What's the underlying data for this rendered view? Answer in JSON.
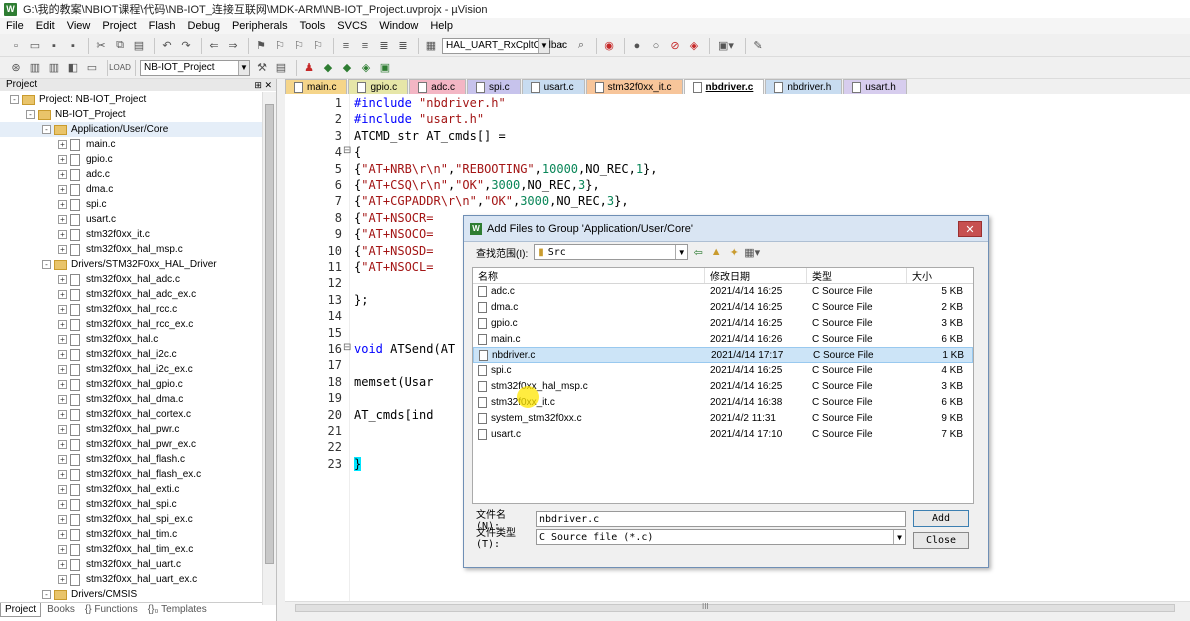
{
  "window": {
    "title": "G:\\我的教案\\NBIOT课程\\代码\\NB-IOT_连接互联网\\MDK-ARM\\NB-IOT_Project.uvprojx - µVision"
  },
  "menu": [
    "File",
    "Edit",
    "View",
    "Project",
    "Flash",
    "Debug",
    "Peripherals",
    "Tools",
    "SVCS",
    "Window",
    "Help"
  ],
  "toolbar": {
    "function_combo": "HAL_UART_RxCpltCallbac",
    "target_combo": "NB-IOT_Project"
  },
  "project_panel": {
    "title": "Project",
    "tree": [
      {
        "level": 0,
        "kind": "root",
        "label": "Project: NB-IOT_Project",
        "exp": "-"
      },
      {
        "level": 1,
        "kind": "target",
        "label": "NB-IOT_Project",
        "exp": "-"
      },
      {
        "level": 2,
        "kind": "folder",
        "label": "Application/User/Core",
        "exp": "-"
      },
      {
        "level": 3,
        "kind": "file",
        "label": "main.c",
        "exp": "+"
      },
      {
        "level": 3,
        "kind": "file",
        "label": "gpio.c",
        "exp": "+"
      },
      {
        "level": 3,
        "kind": "file",
        "label": "adc.c",
        "exp": "+"
      },
      {
        "level": 3,
        "kind": "file",
        "label": "dma.c",
        "exp": "+"
      },
      {
        "level": 3,
        "kind": "file",
        "label": "spi.c",
        "exp": "+"
      },
      {
        "level": 3,
        "kind": "file",
        "label": "usart.c",
        "exp": "+"
      },
      {
        "level": 3,
        "kind": "file",
        "label": "stm32f0xx_it.c",
        "exp": "+"
      },
      {
        "level": 3,
        "kind": "file",
        "label": "stm32f0xx_hal_msp.c",
        "exp": "+"
      },
      {
        "level": 2,
        "kind": "folder",
        "label": "Drivers/STM32F0xx_HAL_Driver",
        "exp": "-"
      },
      {
        "level": 3,
        "kind": "file",
        "label": "stm32f0xx_hal_adc.c",
        "exp": "+"
      },
      {
        "level": 3,
        "kind": "file",
        "label": "stm32f0xx_hal_adc_ex.c",
        "exp": "+"
      },
      {
        "level": 3,
        "kind": "file",
        "label": "stm32f0xx_hal_rcc.c",
        "exp": "+"
      },
      {
        "level": 3,
        "kind": "file",
        "label": "stm32f0xx_hal_rcc_ex.c",
        "exp": "+"
      },
      {
        "level": 3,
        "kind": "file",
        "label": "stm32f0xx_hal.c",
        "exp": "+"
      },
      {
        "level": 3,
        "kind": "file",
        "label": "stm32f0xx_hal_i2c.c",
        "exp": "+"
      },
      {
        "level": 3,
        "kind": "file",
        "label": "stm32f0xx_hal_i2c_ex.c",
        "exp": "+"
      },
      {
        "level": 3,
        "kind": "file",
        "label": "stm32f0xx_hal_gpio.c",
        "exp": "+"
      },
      {
        "level": 3,
        "kind": "file",
        "label": "stm32f0xx_hal_dma.c",
        "exp": "+"
      },
      {
        "level": 3,
        "kind": "file",
        "label": "stm32f0xx_hal_cortex.c",
        "exp": "+"
      },
      {
        "level": 3,
        "kind": "file",
        "label": "stm32f0xx_hal_pwr.c",
        "exp": "+"
      },
      {
        "level": 3,
        "kind": "file",
        "label": "stm32f0xx_hal_pwr_ex.c",
        "exp": "+"
      },
      {
        "level": 3,
        "kind": "file",
        "label": "stm32f0xx_hal_flash.c",
        "exp": "+"
      },
      {
        "level": 3,
        "kind": "file",
        "label": "stm32f0xx_hal_flash_ex.c",
        "exp": "+"
      },
      {
        "level": 3,
        "kind": "file",
        "label": "stm32f0xx_hal_exti.c",
        "exp": "+"
      },
      {
        "level": 3,
        "kind": "file",
        "label": "stm32f0xx_hal_spi.c",
        "exp": "+"
      },
      {
        "level": 3,
        "kind": "file",
        "label": "stm32f0xx_hal_spi_ex.c",
        "exp": "+"
      },
      {
        "level": 3,
        "kind": "file",
        "label": "stm32f0xx_hal_tim.c",
        "exp": "+"
      },
      {
        "level": 3,
        "kind": "file",
        "label": "stm32f0xx_hal_tim_ex.c",
        "exp": "+"
      },
      {
        "level": 3,
        "kind": "file",
        "label": "stm32f0xx_hal_uart.c",
        "exp": "+"
      },
      {
        "level": 3,
        "kind": "file",
        "label": "stm32f0xx_hal_uart_ex.c",
        "exp": "+"
      },
      {
        "level": 2,
        "kind": "folder",
        "label": "Drivers/CMSIS",
        "exp": "-"
      }
    ],
    "bottom_tabs": [
      "Project",
      "Books",
      "{} Functions",
      "{}₀ Templates"
    ]
  },
  "editor_tabs": [
    {
      "label": "main.c",
      "color": "#f5d58a"
    },
    {
      "label": "gpio.c",
      "color": "#e6e6a8"
    },
    {
      "label": "adc.c",
      "color": "#f3b6c4"
    },
    {
      "label": "spi.c",
      "color": "#c7c3ec"
    },
    {
      "label": "usart.c",
      "color": "#c8dcf0"
    },
    {
      "label": "stm32f0xx_it.c",
      "color": "#f7c59a"
    },
    {
      "label": "nbdriver.c",
      "color": "#ffffff",
      "active": true
    },
    {
      "label": "nbdriver.h",
      "color": "#c8dcf0"
    },
    {
      "label": "usart.h",
      "color": "#d7cdee"
    }
  ],
  "code_lines": [
    {
      "n": "1",
      "fold": "",
      "text": "#include \"nbdriver.h\""
    },
    {
      "n": "2",
      "fold": "",
      "text": "#include \"usart.h\""
    },
    {
      "n": "3",
      "fold": "",
      "text": "ATCMD_str AT_cmds[] ="
    },
    {
      "n": "4",
      "fold": "⊟",
      "text": "{"
    },
    {
      "n": "5",
      "fold": "",
      "text": "  {\"AT+NRB\\r\\n\",\"REBOOTING\",10000,NO_REC,1},"
    },
    {
      "n": "6",
      "fold": "",
      "text": "  {\"AT+CSQ\\r\\n\",\"OK\",3000,NO_REC,3},"
    },
    {
      "n": "7",
      "fold": "",
      "text": "  {\"AT+CGPADDR\\r\\n\",\"OK\",3000,NO_REC,3},"
    },
    {
      "n": "8",
      "fold": "",
      "text": "  {\"AT+NSOCR="
    },
    {
      "n": "9",
      "fold": "",
      "text": "  {\"AT+NSOCO="
    },
    {
      "n": "10",
      "fold": "",
      "text": "  {\"AT+NSOSD="
    },
    {
      "n": "11",
      "fold": "",
      "text": "  {\"AT+NSOCL="
    },
    {
      "n": "12",
      "fold": "",
      "text": ""
    },
    {
      "n": "13",
      "fold": "",
      "text": "};"
    },
    {
      "n": "14",
      "fold": "",
      "text": ""
    },
    {
      "n": "15",
      "fold": "",
      "text": ""
    },
    {
      "n": "16",
      "fold": "⊟",
      "text": "void ATSend(AT"
    },
    {
      "n": "17",
      "fold": "",
      "text": ""
    },
    {
      "n": "18",
      "fold": "",
      "text": "  memset(Usar"
    },
    {
      "n": "19",
      "fold": "",
      "text": ""
    },
    {
      "n": "20",
      "fold": "",
      "text": "  AT_cmds[ind"
    },
    {
      "n": "21",
      "fold": "",
      "text": ""
    },
    {
      "n": "22",
      "fold": "",
      "text": ""
    },
    {
      "n": "23",
      "fold": "",
      "text": "}"
    }
  ],
  "dialog": {
    "title": "Add Files to Group 'Application/User/Core'",
    "look_in_label": "查找范围(I):",
    "look_in_value": "Src",
    "columns": {
      "name": "名称",
      "date": "修改日期",
      "type": "类型",
      "size": "大小"
    },
    "files": [
      {
        "name": "adc.c",
        "date": "2021/4/14 16:25",
        "type": "C Source File",
        "size": "5 KB"
      },
      {
        "name": "dma.c",
        "date": "2021/4/14 16:25",
        "type": "C Source File",
        "size": "2 KB"
      },
      {
        "name": "gpio.c",
        "date": "2021/4/14 16:25",
        "type": "C Source File",
        "size": "3 KB"
      },
      {
        "name": "main.c",
        "date": "2021/4/14 16:26",
        "type": "C Source File",
        "size": "6 KB"
      },
      {
        "name": "nbdriver.c",
        "date": "2021/4/14 17:17",
        "type": "C Source File",
        "size": "1 KB",
        "selected": true
      },
      {
        "name": "spi.c",
        "date": "2021/4/14 16:25",
        "type": "C Source File",
        "size": "4 KB"
      },
      {
        "name": "stm32f0xx_hal_msp.c",
        "date": "2021/4/14 16:25",
        "type": "C Source File",
        "size": "3 KB"
      },
      {
        "name": "stm32f0xx_it.c",
        "date": "2021/4/14 16:38",
        "type": "C Source File",
        "size": "6 KB"
      },
      {
        "name": "system_stm32f0xx.c",
        "date": "2021/4/2 11:31",
        "type": "C Source File",
        "size": "9 KB"
      },
      {
        "name": "usart.c",
        "date": "2021/4/14 17:10",
        "type": "C Source File",
        "size": "7 KB"
      }
    ],
    "filename_label": "文件名(N):",
    "filename_value": "nbdriver.c",
    "filetype_label": "文件类型(T):",
    "filetype_value": "C Source file (*.c)",
    "add_label": "Add",
    "close_label": "Close"
  },
  "hscroll_marker": "III",
  "colors": {
    "string": "#a31515",
    "keyword": "#0000ff",
    "number": "#098658",
    "accent": "#d9e5f3"
  }
}
